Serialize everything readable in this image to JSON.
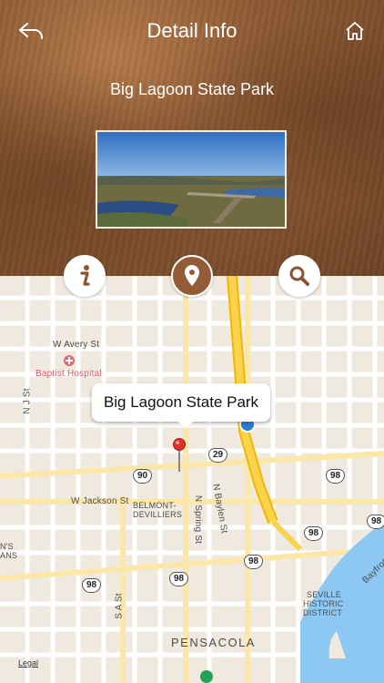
{
  "nav": {
    "title": "Detail Info"
  },
  "place": {
    "name": "Big Lagoon State Park"
  },
  "callout": {
    "text": "Big Lagoon State Park"
  },
  "map": {
    "labels": {
      "avery_st": "W Avery St",
      "baptist": "Baptist Hospital",
      "nj_st": "N J St",
      "jackson_st": "W Jackson St",
      "belmont": "BELMONT-",
      "devilliers": "DEVILLIERS",
      "spring_st": "N Spring St",
      "baylen_st": "N Baylen St",
      "sa_st": "S A St",
      "bayfront": "Bayfron",
      "seville_1": "SEVILLE",
      "seville_2": "HISTORIC",
      "seville_3": "DISTRICT",
      "pensacola": "PENSACOLA",
      "ns_1": "N'S",
      "ns_2": "ANS"
    },
    "routes": {
      "r29": "29",
      "r90": "90",
      "r98a": "98",
      "r98b": "98",
      "r98c": "98",
      "r98d": "98",
      "r98e": "98",
      "r98f": "98"
    },
    "legal": "Legal"
  },
  "icons": {
    "back": "back-arrow-icon",
    "home": "home-icon",
    "info": "info-icon",
    "pin": "location-pin-icon",
    "search": "search-icon"
  },
  "colors": {
    "header": "#8e5a33",
    "active_button": "#935c36",
    "highway": "#f7c948",
    "pin": "#e0302b"
  }
}
